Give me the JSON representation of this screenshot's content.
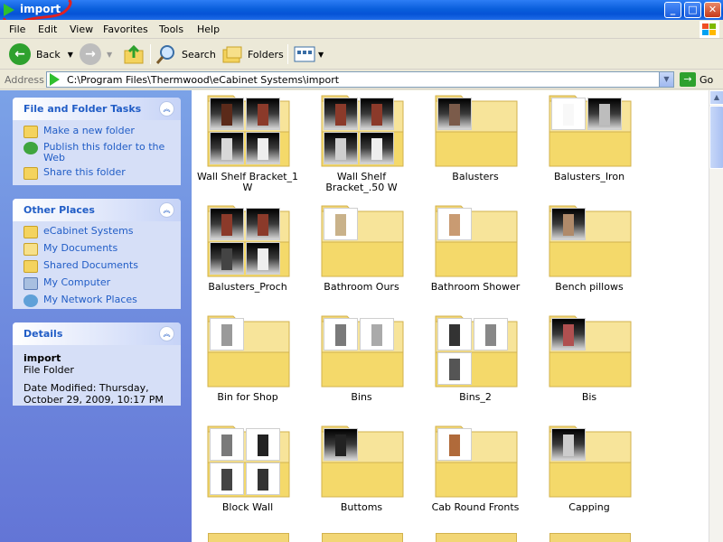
{
  "window": {
    "title": "import",
    "buttons": {
      "minimize": "_",
      "maximize": "□",
      "close": "✕"
    }
  },
  "menubar": {
    "items": [
      "File",
      "Edit",
      "View",
      "Favorites",
      "Tools",
      "Help"
    ]
  },
  "toolbar": {
    "back_label": "Back",
    "search_label": "Search",
    "folders_label": "Folders"
  },
  "address": {
    "label": "Address",
    "value": "C:\\Program Files\\Thermwood\\eCabinet Systems\\import",
    "go_label": "Go"
  },
  "left_pane": {
    "file_tasks": {
      "title": "File and Folder Tasks",
      "items": [
        "Make a new folder",
        "Publish this folder to the Web",
        "Share this folder"
      ]
    },
    "other_places": {
      "title": "Other Places",
      "items": [
        "eCabinet Systems",
        "My Documents",
        "Shared Documents",
        "My Computer",
        "My Network Places"
      ]
    },
    "details": {
      "title": "Details",
      "name": "import",
      "type": "File Folder",
      "modified": "Date Modified: Thursday, October 29, 2009, 10:17 PM"
    }
  },
  "folders": [
    {
      "name": "Wall Shelf Bracket_1 W"
    },
    {
      "name": "Wall Shelf Bracket_.50 W"
    },
    {
      "name": "Balusters"
    },
    {
      "name": "Balusters_Iron"
    },
    {
      "name": "Balusters_Proch"
    },
    {
      "name": "Bathroom Ours"
    },
    {
      "name": "Bathroom Shower"
    },
    {
      "name": "Bench pillows"
    },
    {
      "name": "Bin for Shop"
    },
    {
      "name": "Bins"
    },
    {
      "name": "Bins_2"
    },
    {
      "name": "Bis"
    },
    {
      "name": "Block Wall"
    },
    {
      "name": "Buttoms"
    },
    {
      "name": "Cab Round Fronts"
    },
    {
      "name": "Capping"
    }
  ]
}
